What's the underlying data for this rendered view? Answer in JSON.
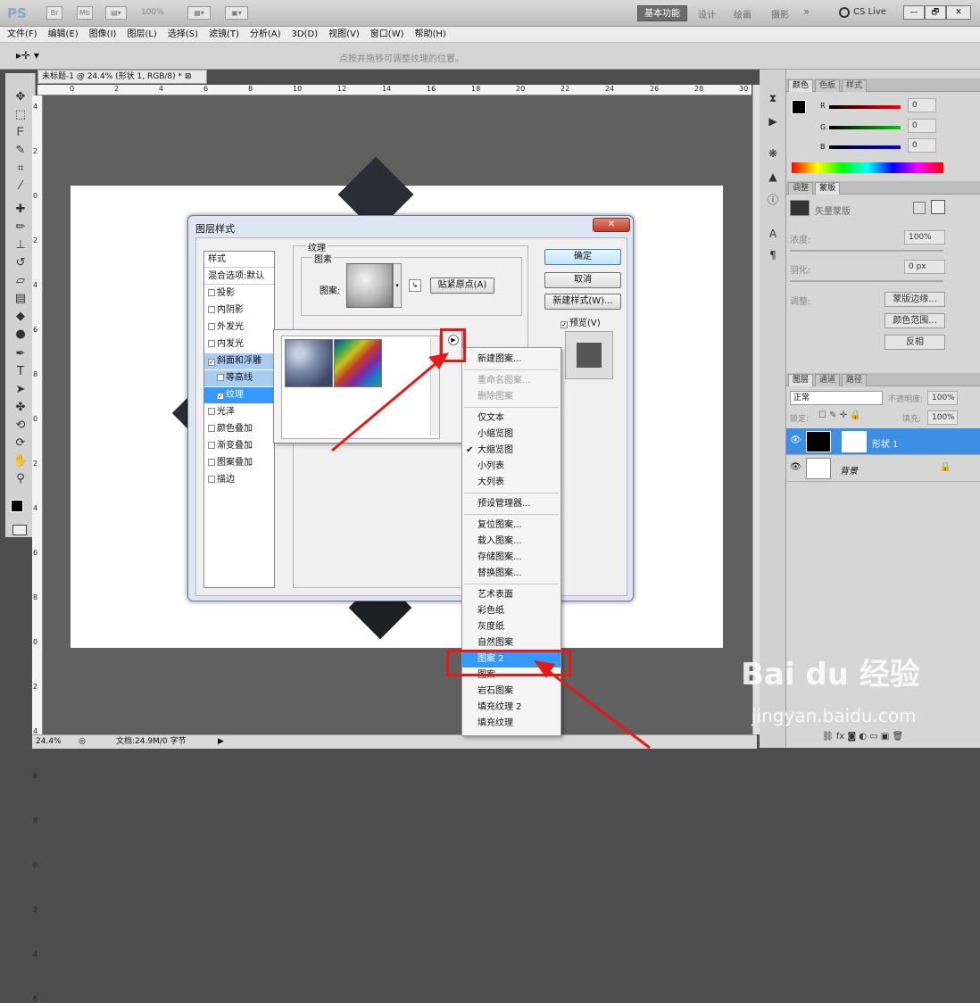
{
  "app": {
    "logo": "PS",
    "bridge_btn": "Br",
    "minibridge_btn": "Mb",
    "zoom": "100%",
    "workspaces": [
      "基本功能",
      "设计",
      "绘画",
      "摄影"
    ],
    "more": "»",
    "cslive": "CS Live",
    "window_buttons": [
      "—",
      "🗗",
      "✕"
    ]
  },
  "menubar": [
    "文件(F)",
    "编辑(E)",
    "图像(I)",
    "图层(L)",
    "选择(S)",
    "滤镜(T)",
    "分析(A)",
    "3D(D)",
    "视图(V)",
    "窗口(W)",
    "帮助(H)"
  ],
  "options_hint": "点按并拖移可调整纹理的位置。",
  "document": {
    "tab_title": "未标题-1 @ 24.4% (形状 1, RGB/8) *",
    "ruler_h": [
      "0",
      "2",
      "4",
      "6",
      "8",
      "10",
      "12",
      "14",
      "16",
      "18",
      "20",
      "22",
      "24",
      "26",
      "28",
      "30"
    ],
    "ruler_v": [
      "4",
      "2",
      "0",
      "2",
      "4",
      "6",
      "8",
      "0",
      "2",
      "4",
      "6",
      "8",
      "0",
      "2",
      "4",
      "6",
      "8",
      "0",
      "2",
      "4",
      "6"
    ],
    "zoom_status": "24.4%",
    "doc_status": "文档:24.9M/0 字节"
  },
  "color_panel": {
    "tabs": [
      "颜色",
      "色板",
      "样式"
    ],
    "channels": [
      {
        "label": "R",
        "value": "0"
      },
      {
        "label": "G",
        "value": "0"
      },
      {
        "label": "B",
        "value": "0"
      }
    ]
  },
  "adjust_panel": {
    "tabs": [
      "调整",
      "蒙版"
    ],
    "title": "矢量蒙版",
    "density_label": "浓度:",
    "density_value": "100%",
    "feather_label": "羽化:",
    "feather_value": "0 px",
    "refine_label": "调整:",
    "btn_edge": "蒙版边缘...",
    "btn_range": "颜色范围...",
    "btn_invert": "反相"
  },
  "layers_panel": {
    "tabs": [
      "图层",
      "通道",
      "路径"
    ],
    "blend_mode": "正常",
    "opacity_label": "不透明度:",
    "opacity": "100%",
    "lock_label": "锁定:",
    "fill_label": "填充:",
    "fill": "100%",
    "layers": [
      {
        "name": "形状 1",
        "selected": true
      },
      {
        "name": "背景",
        "selected": false
      }
    ]
  },
  "dialog": {
    "title": "图层样式",
    "close": "✕",
    "style_list": [
      {
        "label": "样式",
        "check": false,
        "header": true
      },
      {
        "label": "混合选项:默认",
        "check": false,
        "header": true
      },
      {
        "label": "投影",
        "check": true,
        "checked": false
      },
      {
        "label": "内阴影",
        "check": true,
        "checked": false
      },
      {
        "label": "外发光",
        "check": true,
        "checked": false
      },
      {
        "label": "内发光",
        "check": true,
        "checked": false
      },
      {
        "label": "斜面和浮雕",
        "check": true,
        "checked": true
      },
      {
        "label": "等高线",
        "check": true,
        "checked": false,
        "indent": true
      },
      {
        "label": "纹理",
        "check": true,
        "checked": true,
        "indent": true,
        "selected": true
      },
      {
        "label": "光泽",
        "check": true,
        "checked": false
      },
      {
        "label": "颜色叠加",
        "check": true,
        "checked": false
      },
      {
        "label": "渐变叠加",
        "check": true,
        "checked": false
      },
      {
        "label": "图案叠加",
        "check": true,
        "checked": false
      },
      {
        "label": "描边",
        "check": true,
        "checked": false
      }
    ],
    "section_title": "纹理",
    "group_title": "图素",
    "pattern_label": "图案:",
    "snap_btn": "贴紧原点(A)",
    "ok": "确定",
    "cancel": "取消",
    "new_style": "新建样式(W)...",
    "preview_label": "预览(V)"
  },
  "context_menu": [
    {
      "label": "新建图案...",
      "disabled": false
    },
    {
      "sep": true
    },
    {
      "label": "重命名图案...",
      "disabled": true
    },
    {
      "label": "删除图案",
      "disabled": true
    },
    {
      "sep": true
    },
    {
      "label": "仅文本"
    },
    {
      "label": "小缩览图"
    },
    {
      "label": "大缩览图",
      "checked": true
    },
    {
      "label": "小列表"
    },
    {
      "label": "大列表"
    },
    {
      "sep": true
    },
    {
      "label": "预设管理器..."
    },
    {
      "sep": true
    },
    {
      "label": "复位图案..."
    },
    {
      "label": "载入图案..."
    },
    {
      "label": "存储图案..."
    },
    {
      "label": "替换图案..."
    },
    {
      "sep": true
    },
    {
      "label": "艺术表面"
    },
    {
      "label": "彩色纸"
    },
    {
      "label": "灰度纸"
    },
    {
      "label": "自然图案"
    },
    {
      "label": "图案 2",
      "highlight": true
    },
    {
      "label": "图案"
    },
    {
      "label": "岩石图案"
    },
    {
      "label": "填充纹理 2"
    },
    {
      "label": "填充纹理"
    }
  ],
  "watermark": {
    "brand": "Bai du 经验",
    "url": "jingyan.baidu.com"
  },
  "colors": {
    "annotation_red": "#e81818",
    "selection_blue": "#3399ff"
  }
}
